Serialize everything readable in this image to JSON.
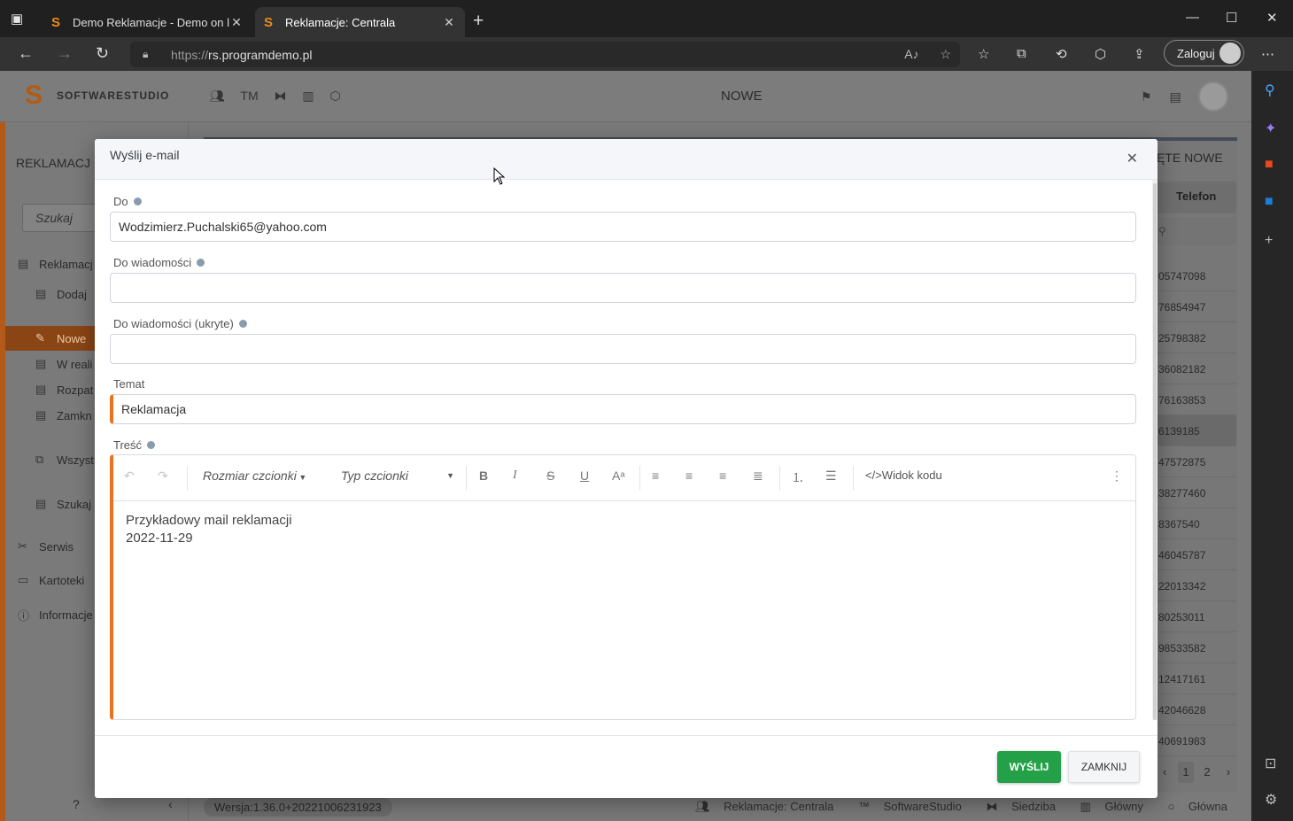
{
  "browser": {
    "tabs": [
      {
        "title": "Demo Reklamacje - Demo on lin",
        "favicon": "S"
      },
      {
        "title": "Reklamacje: Centrala",
        "favicon": "S"
      }
    ],
    "url_protocol": "https://",
    "url_host": "rs.programdemo.pl",
    "login_label": "Zaloguj"
  },
  "app": {
    "logo_text": "SOFTWARESTUDIO",
    "header_title": "NOWE",
    "header_icons_text": "TM",
    "sidebar": {
      "title": "REKLAMACJ",
      "search_placeholder": "Szukaj",
      "items": [
        {
          "label": "Reklamacj"
        },
        {
          "label": "Dodaj"
        },
        {
          "label": "Nowe"
        },
        {
          "label": "W reali"
        },
        {
          "label": "Rozpat"
        },
        {
          "label": "Zamkn"
        },
        {
          "label": "Wszyst"
        },
        {
          "label": "Szukaj"
        },
        {
          "label": "Serwis"
        },
        {
          "label": "Kartoteki"
        },
        {
          "label": "Informacje"
        }
      ]
    },
    "background_table": {
      "heading": "ĘTE NOWE",
      "column": "Telefon",
      "rows": [
        "05747098",
        "76854947",
        "25798382",
        "36082182",
        "76163853",
        "6139185",
        "47572875",
        "38277460",
        "8367540",
        "46045787",
        "22013342",
        "80253011",
        "98533582",
        "12417161",
        "42046628",
        "40691983"
      ],
      "pages": [
        "1",
        "2"
      ]
    },
    "footer": {
      "version": "Wersja:1.36.0+20221006231923",
      "links": [
        "Reklamacje: Centrala",
        "SoftwareStudio",
        "Siedziba",
        "Główny",
        "Główna"
      ]
    }
  },
  "modal": {
    "title": "Wyślij e-mail",
    "fields": {
      "to_label": "Do",
      "to_value": "Wodzimierz.Puchalski65@yahoo.com",
      "cc_label": "Do wiadomości",
      "cc_value": "",
      "bcc_label": "Do wiadomości (ukryte)",
      "bcc_value": "",
      "subject_label": "Temat",
      "subject_value": "Reklamacja",
      "body_label": "Treść"
    },
    "editor": {
      "font_size_label": "Rozmiar czcionki",
      "font_type_label": "Typ czcionki",
      "code_view_label": "Widok kodu",
      "body_line1": "Przykładowy mail reklamacji",
      "body_line2": "2022-11-29"
    },
    "send_label": "WYŚLIJ",
    "close_label": "ZAMKNIJ"
  },
  "colors": {
    "accent_orange": "#e8721d",
    "send_green": "#24a148"
  }
}
